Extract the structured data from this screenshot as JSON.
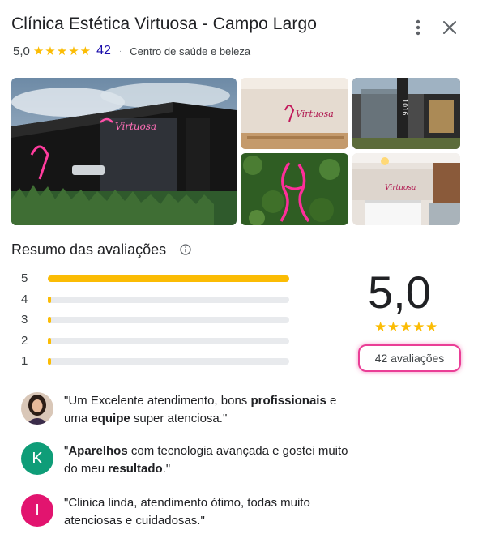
{
  "place": {
    "name": "Clínica Estética Virtuosa - Campo Largo",
    "rating": "5,0",
    "stars": "★★★★★",
    "review_count": "42",
    "separator": "·",
    "category": "Centro de saúde e beleza"
  },
  "header_actions": {
    "more_icon": "more-vert-icon",
    "close_icon": "close-icon"
  },
  "summary": {
    "title": "Resumo das avaliações",
    "info_icon": "info-icon",
    "distribution": [
      {
        "stars": "5",
        "fraction": 1.0
      },
      {
        "stars": "4",
        "fraction": 0.0
      },
      {
        "stars": "3",
        "fraction": 0.0
      },
      {
        "stars": "2",
        "fraction": 0.0
      },
      {
        "stars": "1",
        "fraction": 0.0
      }
    ],
    "average": "5,0",
    "stars": "★★★★★",
    "reviews_link": "42 avaliações"
  },
  "review_snippets": [
    {
      "avatar_type": "photo",
      "parts": [
        {
          "t": "\"Um Excelente atendimento, bons ",
          "b": false
        },
        {
          "t": "profissionais",
          "b": true
        },
        {
          "t": " e uma ",
          "b": false
        },
        {
          "t": "equipe",
          "b": true
        },
        {
          "t": " super atenciosa.\"",
          "b": false
        }
      ]
    },
    {
      "avatar_type": "letter",
      "avatar_letter": "K",
      "avatar_color": "#0f9d78",
      "parts": [
        {
          "t": "\"",
          "b": false
        },
        {
          "t": "Aparelhos",
          "b": true
        },
        {
          "t": " com tecnologia avançada e gostei muito do meu ",
          "b": false
        },
        {
          "t": "resultado",
          "b": true
        },
        {
          "t": ".\"",
          "b": false
        }
      ]
    },
    {
      "avatar_type": "letter",
      "avatar_letter": "I",
      "avatar_color": "#e2146f",
      "parts": [
        {
          "t": "\"Clinica linda, atendimento ótimo, todas muito atenciosas e cuidadosas.\"",
          "b": false
        }
      ]
    }
  ],
  "colors": {
    "star": "#fbbc04",
    "bar_track": "#e8eaed",
    "link_highlight": "#ea3e96",
    "count_link": "#1a0dab"
  }
}
